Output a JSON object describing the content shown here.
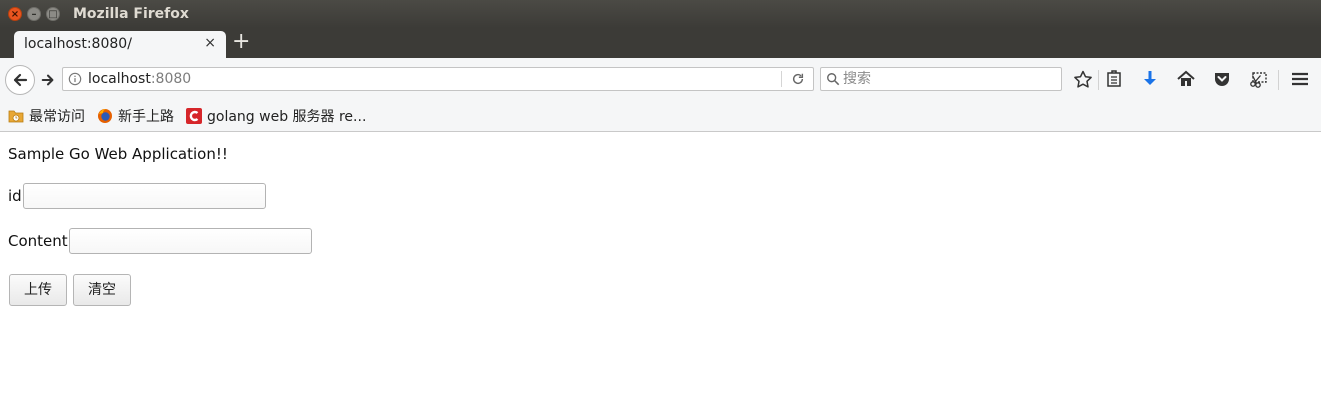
{
  "window": {
    "title": "Mozilla Firefox",
    "controls": {
      "close": "×",
      "minimize": "–",
      "maximize": "□"
    }
  },
  "tabs": [
    {
      "title": "localhost:8080/",
      "close": "×"
    }
  ],
  "new_tab": "+",
  "navbar": {
    "url_host": "localhost",
    "url_port": ":8080",
    "search_placeholder": "搜索",
    "icons": [
      "back-arrow",
      "forward-arrow",
      "info",
      "reload",
      "search",
      "bookmark-star",
      "reading-list",
      "download",
      "home",
      "pocket",
      "screenshot",
      "menu"
    ]
  },
  "bookmarks": [
    {
      "label": "最常访问",
      "icon": "folder-recent-icon"
    },
    {
      "label": "新手上路",
      "icon": "firefox-icon"
    },
    {
      "label": "golang web 服务器 re...",
      "icon": "c-logo-icon"
    }
  ],
  "page": {
    "heading": "Sample Go Web Application!!",
    "form": {
      "id_label": "id",
      "id_value": "",
      "content_label": "Content",
      "content_value": "",
      "upload_button": "上传",
      "clear_button": "清空"
    }
  },
  "colors": {
    "titlebar": "#3c3b37",
    "toolbar": "#f5f6f7",
    "download_accent": "#1a73e8",
    "close_button": "#e9541f"
  }
}
